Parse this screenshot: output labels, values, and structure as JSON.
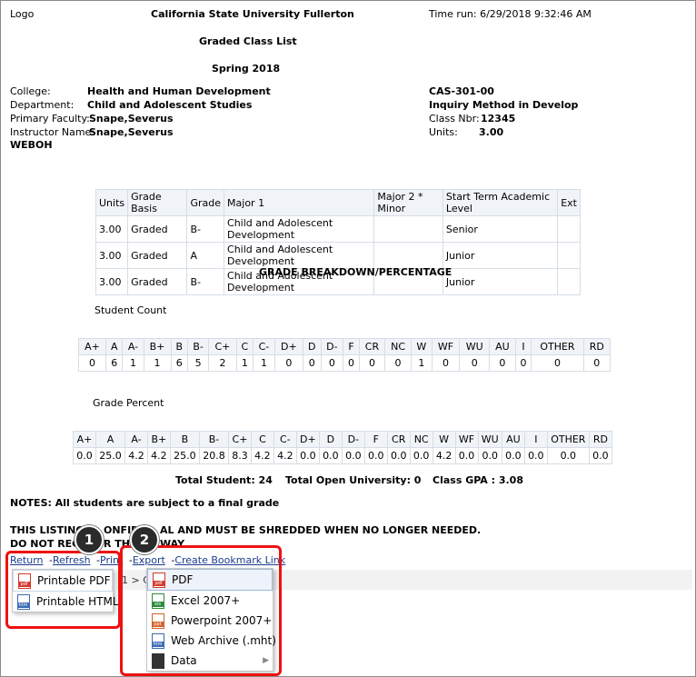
{
  "header": {
    "logo": "Logo",
    "university": "California State University Fullerton",
    "time_run": "Time run: 6/29/2018 9:32:46 AM",
    "report_title": "Graded Class List",
    "term": "Spring 2018"
  },
  "info": {
    "college_label": "College:",
    "college": "Health and Human Development",
    "department_label": "Department:",
    "department": "Child and Adolescent Studies",
    "primary_faculty_label": "Primary Faculty:",
    "primary_faculty": "Snape,Severus",
    "instructor_label": "Instructor Name:",
    "instructor": "Snape,Severus",
    "code": "WEBOH",
    "course": "CAS-301-00",
    "course_title": "Inquiry Method in Develop",
    "class_nbr_label": "Class Nbr:",
    "class_nbr": "12345",
    "units_label": "Units:",
    "units": "3.00"
  },
  "roster": {
    "headers": [
      "Units",
      "Grade Basis",
      "Grade",
      "Major 1",
      "Major 2 * Minor",
      "Start Term Academic Level",
      "Ext"
    ],
    "rows": [
      [
        "3.00",
        "Graded",
        "B-",
        "Child and Adolescent Development",
        "",
        "Senior",
        ""
      ],
      [
        "3.00",
        "Graded",
        "A",
        "Child and Adolescent Development",
        "",
        "Junior",
        ""
      ],
      [
        "3.00",
        "Graded",
        "B-",
        "Child and Adolescent Development",
        "",
        "Junior",
        ""
      ]
    ]
  },
  "breakdown_title": "GRADE BREAKDOWN/PERCENTAGE",
  "count": {
    "label": "Student Count",
    "headers": [
      "A+",
      "A",
      "A-",
      "B+",
      "B",
      "B-",
      "C+",
      "C",
      "C-",
      "D+",
      "D",
      "D-",
      "F",
      "CR",
      "NC",
      "W",
      "WF",
      "WU",
      "AU",
      "I",
      "OTHER",
      "RD"
    ],
    "values": [
      "0",
      "6",
      "1",
      "1",
      "6",
      "5",
      "2",
      "1",
      "1",
      "0",
      "0",
      "0",
      "0",
      "0",
      "0",
      "1",
      "0",
      "0",
      "0",
      "0",
      "0",
      "0"
    ]
  },
  "percent": {
    "label": "Grade Percent",
    "headers": [
      "A+",
      "A",
      "A-",
      "B+",
      "B",
      "B-",
      "C+",
      "C",
      "C-",
      "D+",
      "D",
      "D-",
      "F",
      "CR",
      "NC",
      "W",
      "WF",
      "WU",
      "AU",
      "I",
      "OTHER",
      "RD"
    ],
    "values": [
      "0.0",
      "25.0",
      "4.2",
      "4.2",
      "25.0",
      "20.8",
      "8.3",
      "4.2",
      "4.2",
      "0.0",
      "0.0",
      "0.0",
      "0.0",
      "0.0",
      "0.0",
      "4.2",
      "0.0",
      "0.0",
      "0.0",
      "0.0",
      "0.0",
      "0.0"
    ]
  },
  "totals": {
    "students": "Total Student: 24",
    "open_university": "Total Open University: 0",
    "gpa": "Class GPA : 3.08"
  },
  "notes": "NOTES: All students are subject to a final grade",
  "warning_1a": "THIS LISTING",
  "warning_1b": "ONFID",
  "warning_1c": "AL AND MUST BE SHREDDED WHEN NO LONGER NEEDED.",
  "warning_2a": "DO NOT REC",
  "warning_2b": "R TH",
  "warning_2c": "WAY.",
  "actions": {
    "return": "Return",
    "sep": "-",
    "refresh": "Refresh",
    "print": "Print",
    "export": "Export",
    "bookmark": "Create Bookmark Link"
  },
  "behind_text": "1  >  C",
  "print_menu": [
    {
      "label": "Printable PDF",
      "icon": "pdf-file-icon"
    },
    {
      "label": "Printable HTML",
      "icon": "html-file-icon"
    }
  ],
  "export_menu": [
    {
      "label": "PDF",
      "icon": "pdf-file-icon"
    },
    {
      "label": "Excel 2007+",
      "icon": "excel-file-icon"
    },
    {
      "label": "Powerpoint 2007+",
      "icon": "powerpoint-file-icon"
    },
    {
      "label": "Web Archive (.mht)",
      "icon": "mht-file-icon"
    },
    {
      "label": "Data",
      "icon": "data-file-icon"
    }
  ],
  "callouts": [
    "1",
    "2"
  ],
  "colors": {
    "highlight_box": "#e11111",
    "link": "#1a3a8c",
    "pdf": "#d33a2c",
    "excel": "#2e8b3a",
    "powerpoint": "#d2632a",
    "mht": "#3a6bb5"
  }
}
